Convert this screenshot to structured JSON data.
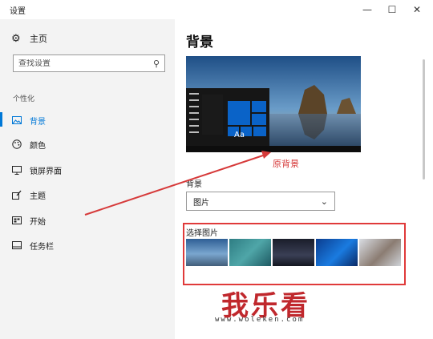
{
  "window": {
    "title": "设置",
    "controls": {
      "minimize": "—",
      "maximize": "☐",
      "close": "✕"
    }
  },
  "sidebar": {
    "home_label": "主页",
    "home_icon": "gear-icon",
    "search": {
      "placeholder": "查找设置",
      "icon": "search-icon"
    },
    "section_label": "个性化",
    "items": [
      {
        "label": "背景",
        "icon": "picture-icon",
        "active": true
      },
      {
        "label": "颜色",
        "icon": "palette-icon",
        "active": false
      },
      {
        "label": "锁屏界面",
        "icon": "monitor-icon",
        "active": false
      },
      {
        "label": "主题",
        "icon": "brush-icon",
        "active": false
      },
      {
        "label": "开始",
        "icon": "start-icon",
        "active": false
      },
      {
        "label": "任务栏",
        "icon": "taskbar-icon",
        "active": false
      }
    ],
    "accent_color": "#0078d7"
  },
  "main": {
    "title": "背景",
    "preview": {
      "tile_text": "Aa",
      "tile_color": "#0a63c8"
    },
    "background_label": "背景",
    "background_select": {
      "value": "图片"
    },
    "choose_picture_label": "选择图片"
  },
  "annotation": {
    "text": "原背景",
    "color": "#d63a3a"
  },
  "watermark": {
    "text": "我乐看",
    "url": "www.woleken.com"
  }
}
